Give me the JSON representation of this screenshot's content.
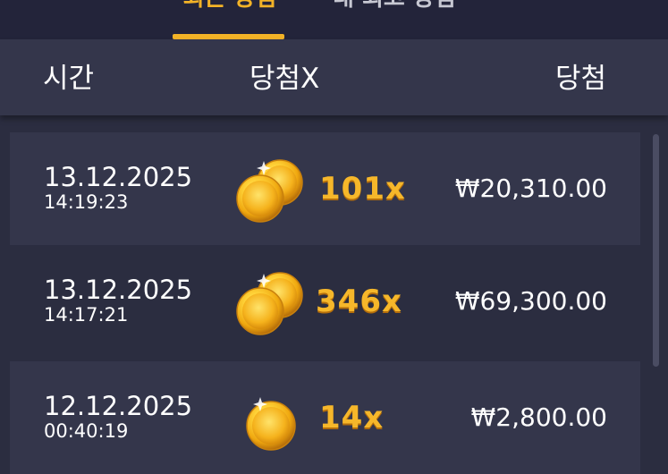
{
  "tabs": {
    "active": "최근 당첨",
    "inactive": "내 최고 당첨"
  },
  "columns": {
    "time": "시간",
    "multiplier": "당첨X",
    "win": "당첨"
  },
  "rows": [
    {
      "date": "13.12.2025",
      "time": "14:19:23",
      "multiplier": "101x",
      "amount": "₩20,310.00",
      "coins": 2
    },
    {
      "date": "13.12.2025",
      "time": "14:17:21",
      "multiplier": "346x",
      "amount": "₩69,300.00",
      "coins": 2
    },
    {
      "date": "12.12.2025",
      "time": "00:40:19",
      "multiplier": "14x",
      "amount": "₩2,800.00",
      "coins": 1
    }
  ],
  "colors": {
    "background": "#2b2d40",
    "row_alt": "#34364b",
    "accent": "#f3b327"
  },
  "icons": {
    "double_coin": "gold-coins-icon",
    "single_coin": "gold-coin-icon"
  }
}
